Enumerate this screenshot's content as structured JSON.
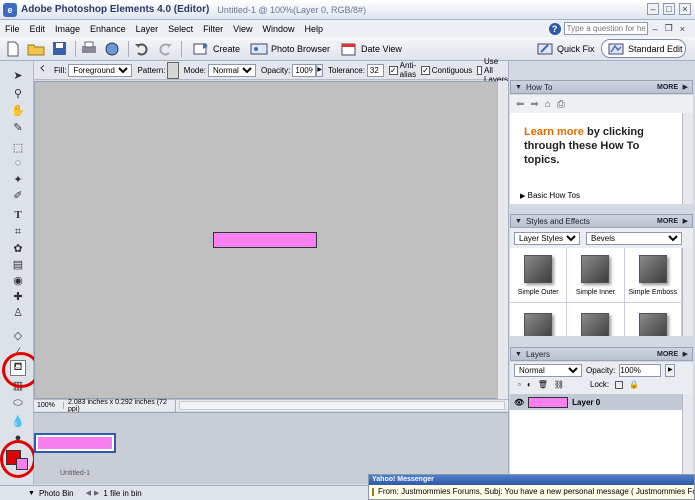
{
  "title_bar": {
    "app": "Adobe Photoshop Elements 4.0 (Editor)",
    "document": "Untitled-1 @ 100%(Layer 0, RGB/8#)"
  },
  "menu": [
    "File",
    "Edit",
    "Image",
    "Enhance",
    "Layer",
    "Select",
    "Filter",
    "View",
    "Window",
    "Help"
  ],
  "help": {
    "placeholder": "Type a question for help"
  },
  "shortcuts": {
    "create": "Create",
    "photo_browser": "Photo Browser",
    "date_view": "Date View",
    "quick_fix": "Quick Fix",
    "standard_edit": "Standard Edit"
  },
  "options": {
    "fill_label": "Fill:",
    "fill_value": "Foreground",
    "pattern_label": "Pattern:",
    "mode_label": "Mode:",
    "mode_value": "Normal",
    "opacity_label": "Opacity:",
    "opacity_value": "100%",
    "tolerance_label": "Tolerance:",
    "tolerance_value": "32",
    "antialias_label": "Anti-alias",
    "antialias_checked": true,
    "contiguous_label": "Contiguous",
    "contiguous_checked": true,
    "all_layers_label": "Use All Layers",
    "all_layers_checked": false
  },
  "status": {
    "zoom": "100%",
    "info": "2.083 inches x 0.292 inches (72 ppi)"
  },
  "photo_bin": {
    "thumb_label": "Untitled-1",
    "bin_label": "Photo Bin",
    "count_label": "1 file in bin"
  },
  "colors": {
    "foreground": "#e00000",
    "background": "#f77ff0",
    "layer_fill": "#f77ff0"
  },
  "howto": {
    "title": "How To",
    "more": "MORE",
    "learn_more": "Learn more",
    "learn_rest": " by clicking through these How To topics.",
    "basic": "Basic How Tos"
  },
  "styles": {
    "title": "Styles and Effects",
    "more": "MORE",
    "category": "Layer Styles",
    "library": "Bevels",
    "items": [
      "Simple Outer",
      "Simple Inner",
      "Simple Emboss",
      "",
      "",
      ""
    ]
  },
  "layers": {
    "title": "Layers",
    "more": "MORE",
    "mode": "Normal",
    "opacity_label": "Opacity:",
    "opacity_value": "100%",
    "lock_label": "Lock:",
    "layer_name": "Layer 0"
  },
  "messenger": {
    "title": "Yahoo! Messenger",
    "message": "From: Justmommies Forums, Subj: You have a new personal message ( Justmommies Forums )"
  }
}
